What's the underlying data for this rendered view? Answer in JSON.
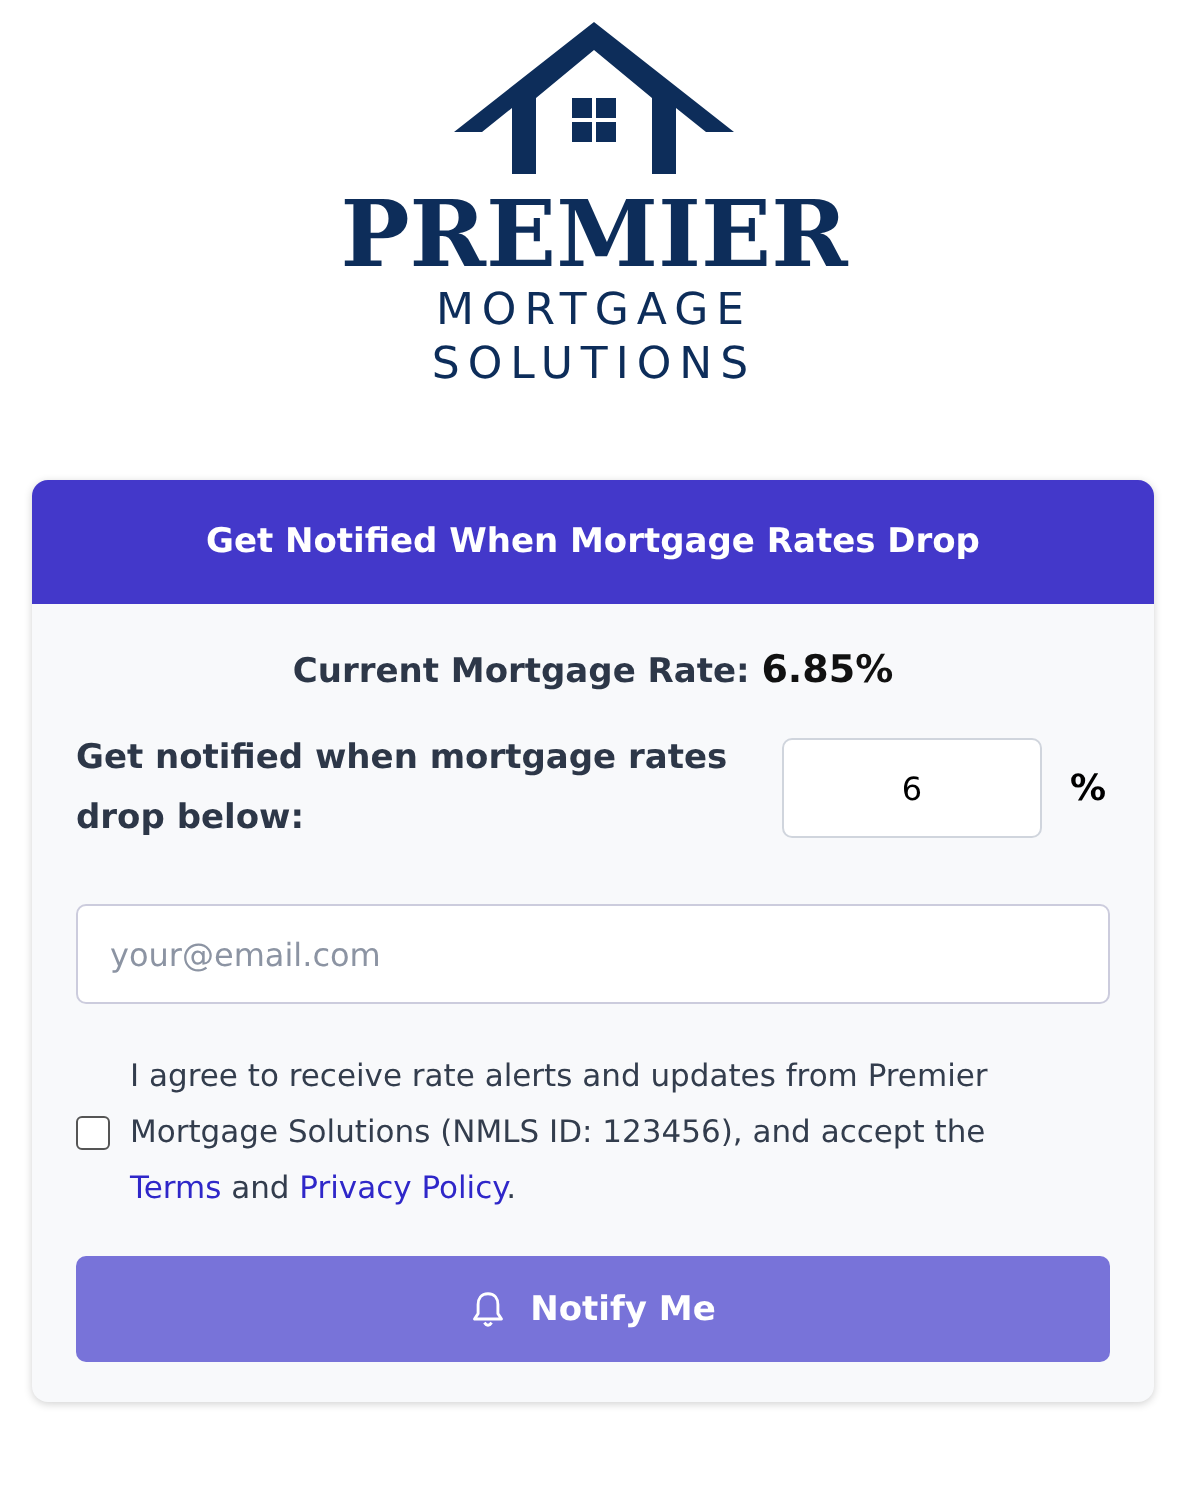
{
  "logo": {
    "name": "PREMIER",
    "line_1": "MORTGAGE",
    "line_2": "SOLUTIONS"
  },
  "card": {
    "title": "Get Notified When Mortgage Rates Drop",
    "current_rate": {
      "label": "Current Mortgage Rate:",
      "value": "6.85%"
    },
    "threshold": {
      "label": "Get notified when mortgage rates drop below:",
      "value": "6",
      "unit": "%"
    },
    "email": {
      "placeholder": "your@email.com"
    },
    "consent": {
      "checked": false,
      "text_before": "I agree to receive rate alerts and updates from Premier Mortgage Solutions (NMLS ID: 123456), and accept the",
      "link_1": "Terms",
      "text_mid": "and",
      "link_2": "Privacy Policy",
      "text_end": "."
    },
    "button": {
      "label": "Notify Me",
      "disabled": true
    }
  }
}
